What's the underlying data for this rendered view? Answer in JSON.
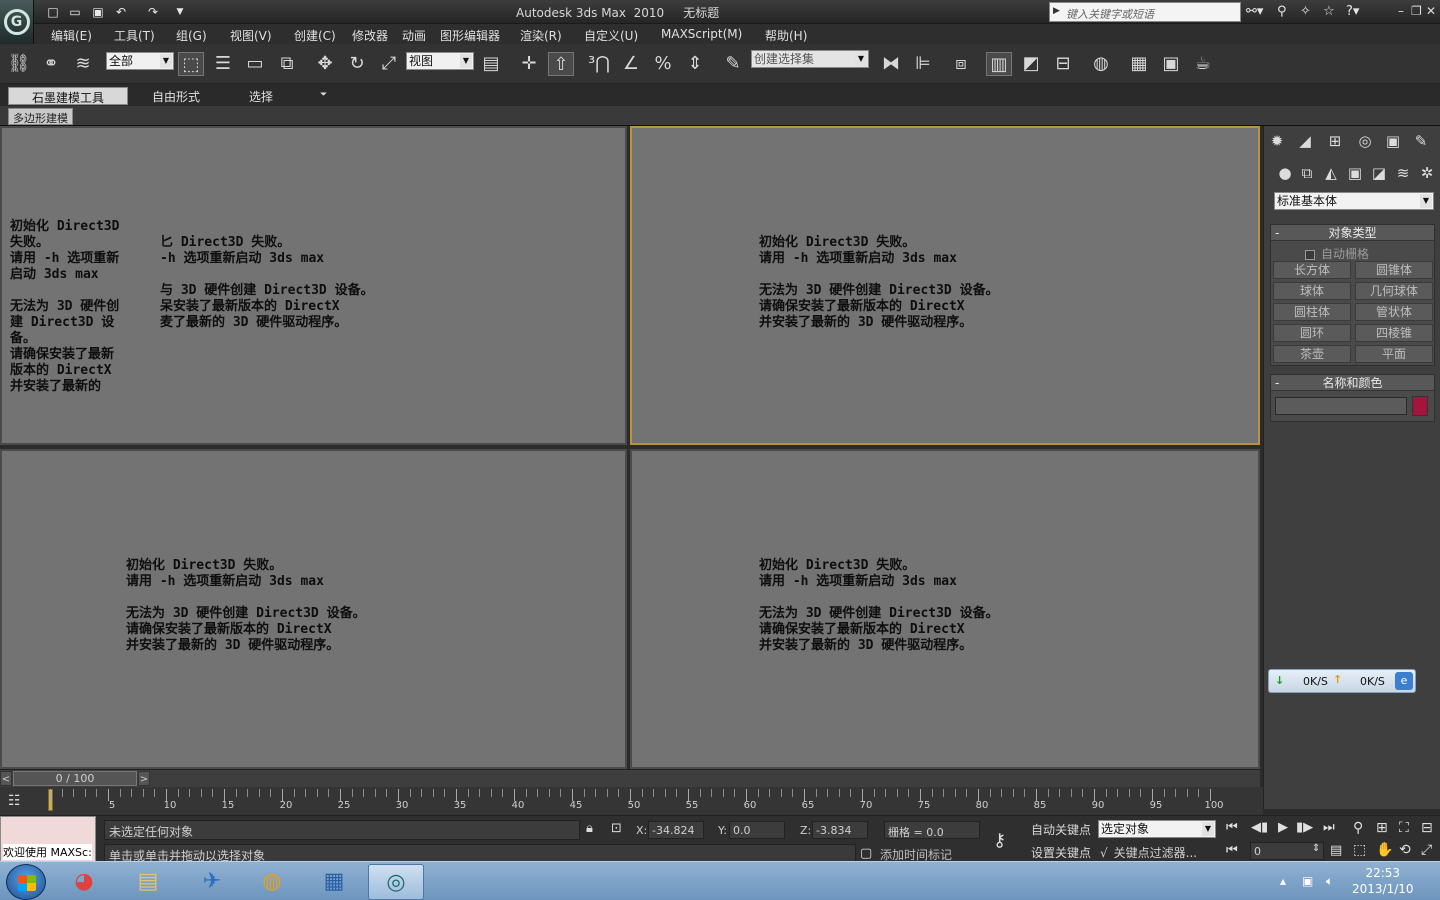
{
  "title_bar": {
    "title": "Autodesk 3ds Max  2010     无标题",
    "search_placeholder": "键入关键字或短语",
    "logo_letter": "G"
  },
  "menus": [
    "编辑(E)",
    "工具(T)",
    "组(G)",
    "视图(V)",
    "创建(C)",
    "修改器",
    "动画",
    "图形编辑器",
    "渲染(R)",
    "自定义(U)",
    "MAXScript(M)",
    "帮助(H)"
  ],
  "toolbar": {
    "filter_combo": "全部",
    "ref_coord_combo": "视图",
    "named_selection_combo": "创建选择集"
  },
  "ribbon": {
    "tabs": [
      "石墨建模工具",
      "自由形式",
      "选择"
    ],
    "active_tab": "石墨建模工具",
    "sub_tab": "多边形建模"
  },
  "viewport_messages": {
    "top_left": "初始化 Direct3D\n失败。\n请用 -h 选项重新\n启动 3ds max\n\n无法为 3D 硬件创\n建 Direct3D 设\n备。\n请确保安装了最新\n版本的 DirectX\n并安装了最新的",
    "top_left_second": "匕 Direct3D 失败。\n-h 选项重新启动 3ds max\n\n与 3D 硬件创建 Direct3D 设备。\n呆安装了最新版本的 DirectX\n麦了最新的 3D 硬件驱动程序。",
    "full": "初始化 Direct3D 失败。\n请用 -h 选项重新启动 3ds max\n\n无法为 3D 硬件创建 Direct3D 设备。\n请确保安装了最新版本的 DirectX\n并安装了最新的 3D 硬件驱动程序。"
  },
  "command_panel": {
    "category_combo": "标准基本体",
    "object_type_title": "对象类型",
    "autogrid_label": "自动栅格",
    "object_buttons": [
      "长方体",
      "圆锥体",
      "球体",
      "几何球体",
      "圆柱体",
      "管状体",
      "圆环",
      "四棱锥",
      "茶壶",
      "平面"
    ],
    "name_color_title": "名称和颜色",
    "object_color": "#a6133d",
    "net_down": "0K/S",
    "net_up": "0K/S"
  },
  "time_slider": {
    "position_label": "0 / 100",
    "left_arrow": "<",
    "right_arrow": ">",
    "ticks": [
      "5",
      "10",
      "15",
      "20",
      "25",
      "30",
      "35",
      "40",
      "45",
      "50",
      "55",
      "60",
      "65",
      "70",
      "75",
      "80",
      "85",
      "90",
      "95",
      "100"
    ]
  },
  "status_bar": {
    "selection_status": "未选定任何对象",
    "prompt": "单击或单击并拖动以选择对象",
    "welcome": "欢迎使用  MAXSc:",
    "x_label": "X:",
    "x_value": "-34.824",
    "y_label": "Y:",
    "y_value": "0.0",
    "z_label": "Z:",
    "z_value": "-3.834",
    "grid": "栅格 = 0.0",
    "add_time_tag": "添加时间标记",
    "auto_key": "自动关键点",
    "set_key": "设置关键点",
    "selected_combo": "选定对象",
    "key_filters": "关键点过滤器...",
    "frame_value": "0"
  },
  "taskbar": {
    "time": "22:53",
    "date": "2013/1/10"
  }
}
